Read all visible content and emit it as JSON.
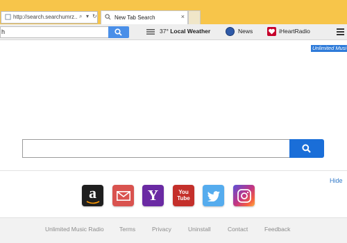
{
  "browser": {
    "address_url": "http://search.searchumrz...",
    "tab_title": "New Tab Search",
    "tab_close": "×"
  },
  "toolbar": {
    "search_value": "h",
    "weather_temp": "37°",
    "weather_label": "Local Weather",
    "news_label": "News",
    "iheart_label": "iHeartRadio"
  },
  "main": {
    "top_link": "Unlimited Musi",
    "search_placeholder": "",
    "hide_label": "Hide"
  },
  "tiles": [
    {
      "name": "amazon",
      "glyph": "a",
      "color": "#222222"
    },
    {
      "name": "gmail",
      "glyph": "✉",
      "color": "#d9534f"
    },
    {
      "name": "yahoo",
      "glyph": "Y",
      "color": "#6a2aa3"
    },
    {
      "name": "youtube",
      "glyph": "You Tube",
      "color": "#c4302b"
    },
    {
      "name": "twitter",
      "glyph": "🐦",
      "color": "#55acee"
    },
    {
      "name": "instagram",
      "glyph": "◎",
      "color": "#c13584"
    }
  ],
  "footer": {
    "links": [
      "Unlimited Music Radio",
      "Terms",
      "Privacy",
      "Uninstall",
      "Contact",
      "Feedback"
    ]
  }
}
